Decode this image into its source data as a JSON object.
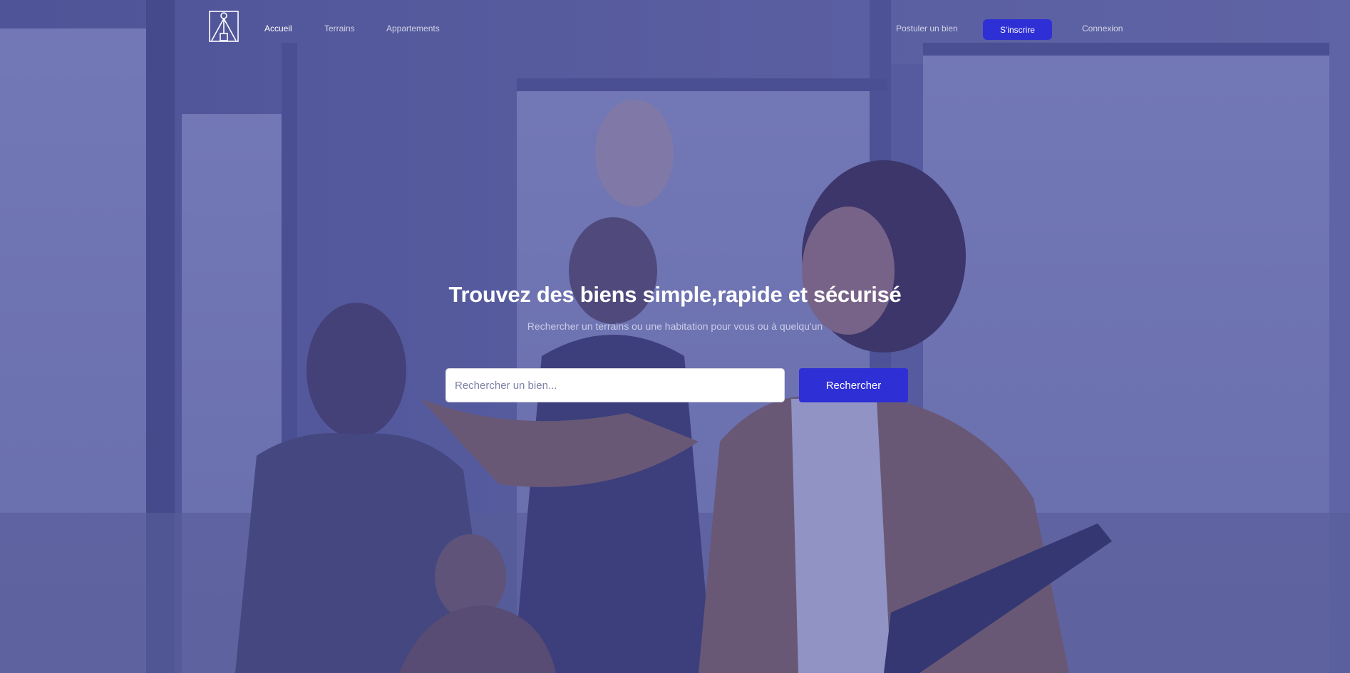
{
  "nav": {
    "logo_icon": "brand-logo-icon",
    "links": {
      "accueil": "Accueil",
      "terrains": "Terrains",
      "appartements": "Appartements",
      "postuler": "Postuler un bien",
      "connexion": "Connexion"
    },
    "signup_label": "S'inscrire"
  },
  "hero": {
    "title": "Trouvez des biens simple,rapide et sécurisé",
    "subtitle": "Rechercher un terrains ou une habitation pour vous ou à quelqu'un",
    "background_icon": "office-team-photo"
  },
  "search": {
    "placeholder": "Rechercher un bien...",
    "button_label": "Rechercher"
  },
  "colors": {
    "accent": "#2f2fd6",
    "overlay": "#3e4296"
  }
}
